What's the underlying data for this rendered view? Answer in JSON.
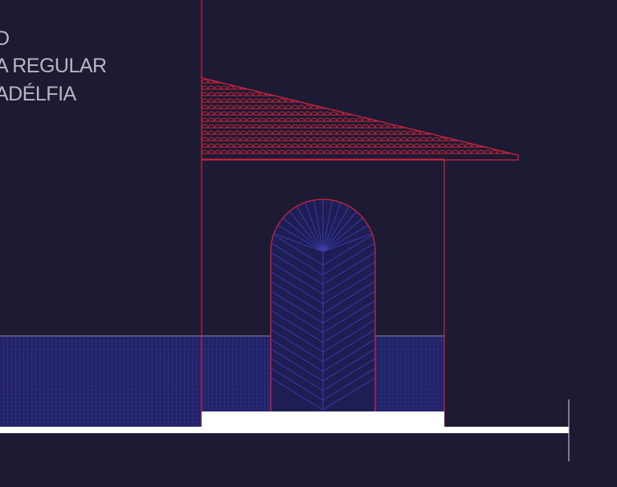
{
  "drawing": {
    "title_lines": [
      "D",
      "A REGULAR",
      "ADÉLFIA"
    ]
  },
  "colors": {
    "background": "#1c1b33",
    "linework": "#d2233d",
    "hatch": "#2a2a8c",
    "ground": "#ffffff",
    "text": "#b7b7c2"
  }
}
